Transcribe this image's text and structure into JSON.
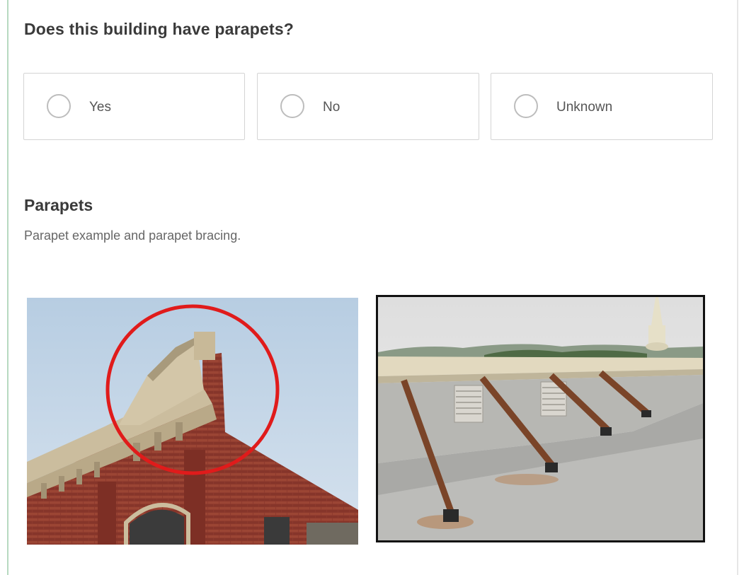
{
  "question": {
    "title": "Does this building have parapets?",
    "options": [
      {
        "label": "Yes",
        "selected": false
      },
      {
        "label": "No",
        "selected": false
      },
      {
        "label": "Unknown",
        "selected": false
      }
    ]
  },
  "section": {
    "title": "Parapets",
    "description": "Parapet example and parapet bracing."
  },
  "colors": {
    "accent_rule": "#b7d9c0",
    "annotation_circle": "#e01b1b",
    "brick": "#8e3a2e",
    "sky": "#c9d9e8"
  },
  "images": [
    {
      "name": "parapet-example-photo",
      "annotation": "red-circle"
    },
    {
      "name": "parapet-bracing-photo"
    }
  ]
}
